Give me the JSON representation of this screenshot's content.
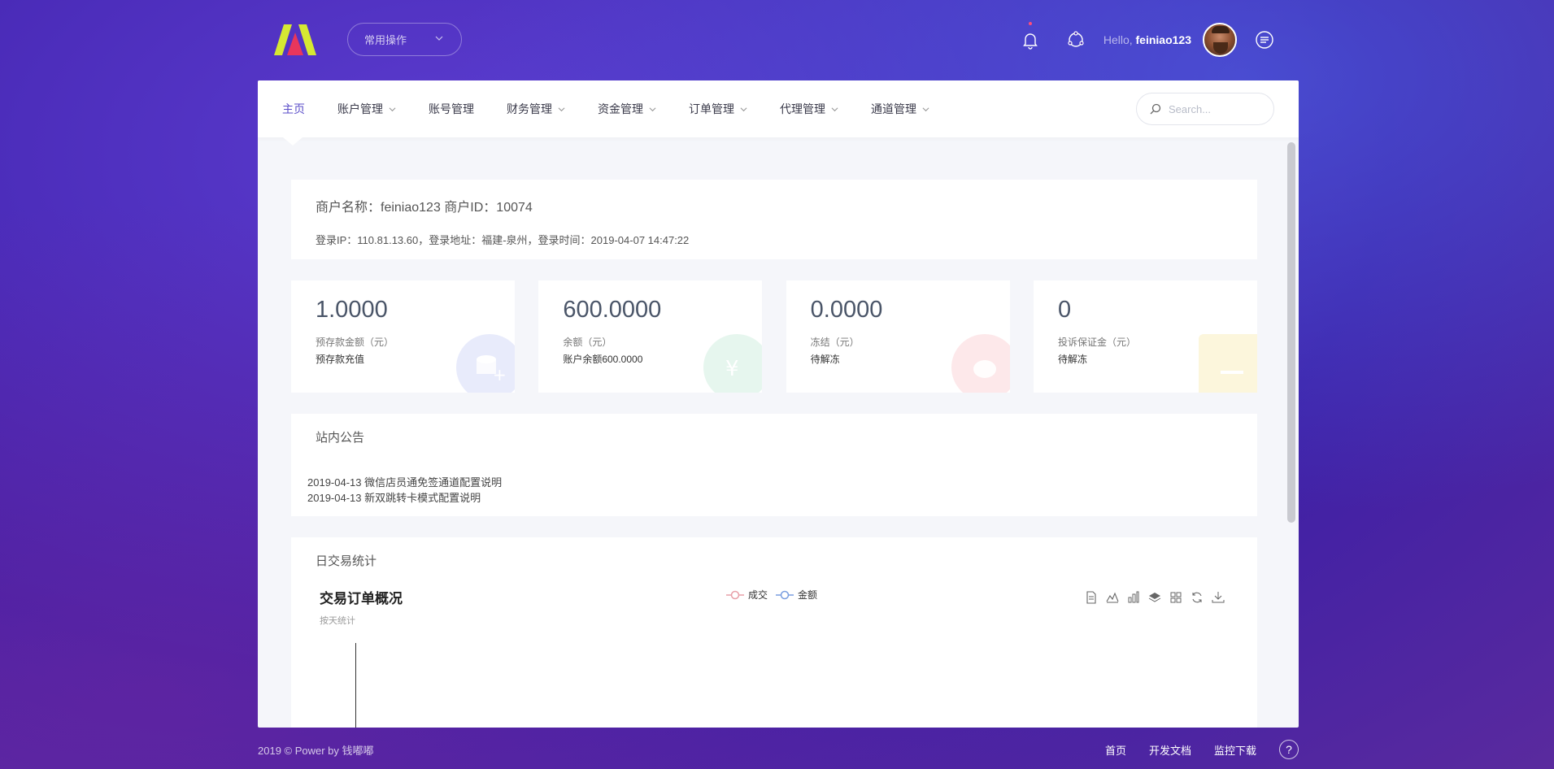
{
  "header": {
    "quick_ops_label": "常用操作",
    "greeting": "Hello,",
    "username": "feiniao123"
  },
  "nav": {
    "items": [
      {
        "label": "主页",
        "active": true,
        "dropdown": false
      },
      {
        "label": "账户管理",
        "dropdown": true
      },
      {
        "label": "账号管理",
        "dropdown": false
      },
      {
        "label": "财务管理",
        "dropdown": true
      },
      {
        "label": "资金管理",
        "dropdown": true
      },
      {
        "label": "订单管理",
        "dropdown": true
      },
      {
        "label": "代理管理",
        "dropdown": true
      },
      {
        "label": "通道管理",
        "dropdown": true
      }
    ],
    "search_placeholder": "Search..."
  },
  "merchant": {
    "line1": "商户名称：feiniao123  商户ID：10074",
    "line2": "登录IP：110.81.13.60，登录地址：福建-泉州，登录时间：2019-04-07 14:47:22"
  },
  "stats": [
    {
      "value": "1.0000",
      "label": "预存款金额（元）",
      "sub": "预存款充值",
      "icon": "coin-add-icon",
      "color": "#e8ebfb"
    },
    {
      "value": "600.0000",
      "label": "余额（元）",
      "sub": "账户余额600.0000",
      "icon": "money-bag-icon",
      "color": "#e6f6ee"
    },
    {
      "value": "0.0000",
      "label": "冻结（元）",
      "sub": "待解冻",
      "icon": "piggy-bank-icon",
      "color": "#fde8ea"
    },
    {
      "value": "0",
      "label": "投诉保证金（元）",
      "sub": "待解冻",
      "icon": "ticket-icon",
      "color": "#fcf6dc"
    }
  ],
  "notice": {
    "title": "站内公告",
    "items": [
      "2019-04-13 微信店员通免签通道配置说明",
      "2019-04-13 新双跳转卡模式配置说明"
    ]
  },
  "chart": {
    "section_title": "日交易统计",
    "title": "交易订单概况",
    "subtitle": "按天统计",
    "legend": [
      {
        "name": "成交",
        "color": "#e8a0a8"
      },
      {
        "name": "金额",
        "color": "#7a9ee0"
      }
    ]
  },
  "footer": {
    "copyright": "2019 © Power by 钱嘟嘟",
    "links": [
      "首页",
      "开发文档",
      "监控下载"
    ],
    "help": "?"
  }
}
